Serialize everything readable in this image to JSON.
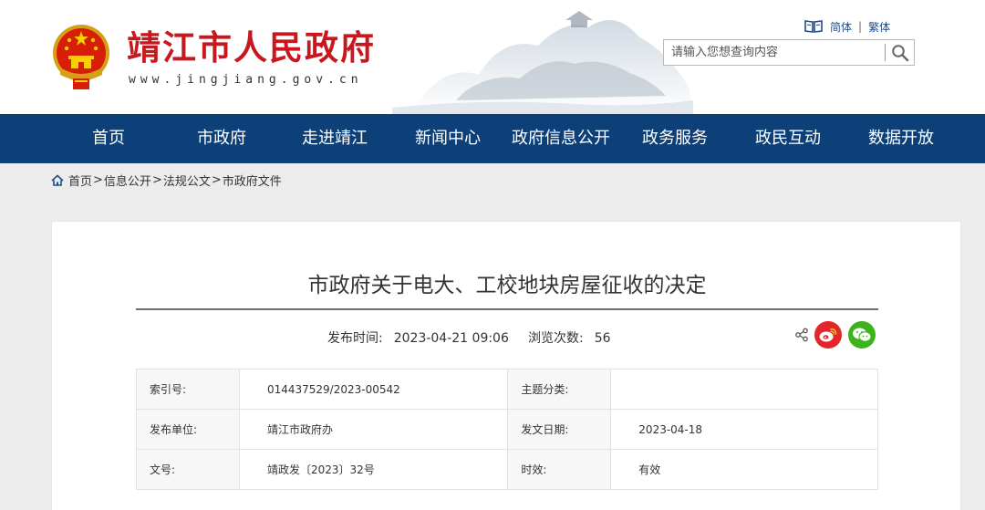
{
  "header": {
    "site_title": "靖江市人民政府",
    "site_url": "www.jingjiang.gov.cn",
    "lang_simplified": "简体",
    "lang_separator": "|",
    "lang_traditional": "繁体",
    "search_placeholder": "请输入您想查询内容",
    "search_value": ""
  },
  "nav": {
    "items": [
      {
        "label": "首页"
      },
      {
        "label": "市政府"
      },
      {
        "label": "走进靖江"
      },
      {
        "label": "新闻中心"
      },
      {
        "label": "政府信息公开"
      },
      {
        "label": "政务服务"
      },
      {
        "label": "政民互动"
      },
      {
        "label": "数据开放"
      }
    ]
  },
  "breadcrumb": {
    "items": [
      "首页",
      "信息公开",
      "法规公文",
      "市政府文件"
    ],
    "separator": ">"
  },
  "article": {
    "title": "市政府关于电大、工校地块房屋征收的决定",
    "publish_time_label": "发布时间:",
    "publish_time": "2023-04-21 09:06",
    "views_label": "浏览次数:",
    "views": "56"
  },
  "info_table": {
    "rows": [
      {
        "label1": "索引号:",
        "value1": "014437529/2023-00542",
        "label2": "主题分类:",
        "value2": ""
      },
      {
        "label1": "发布单位:",
        "value1": "靖江市政府办",
        "label2": "发文日期:",
        "value2": "2023-04-18"
      },
      {
        "label1": "文号:",
        "value1": "靖政发〔2023〕32号",
        "label2": "时效:",
        "value2": "有效"
      }
    ]
  },
  "icons": {
    "emblem": "national-emblem-icon",
    "book": "book-icon",
    "search": "search-icon",
    "home": "home-icon",
    "share": "share-icon",
    "weibo": "weibo-icon",
    "wechat": "wechat-icon"
  },
  "colors": {
    "brand_red": "#c8181e",
    "nav_blue": "#0d3f78",
    "link_blue": "#1d4d8c",
    "weibo_red": "#e2262b",
    "wechat_green": "#3db31b"
  }
}
